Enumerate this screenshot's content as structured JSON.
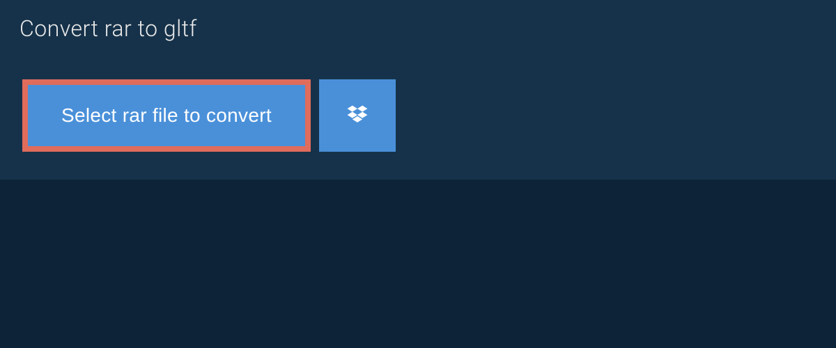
{
  "tab": {
    "title": "Convert rar to gltf"
  },
  "actions": {
    "select_label": "Select rar file to convert",
    "dropbox_icon": "dropbox-icon"
  },
  "colors": {
    "background": "#0d2438",
    "panel": "#16324a",
    "button": "#4a90d9",
    "highlight_border": "#e06c5c",
    "text_light": "#e8e8e8"
  }
}
